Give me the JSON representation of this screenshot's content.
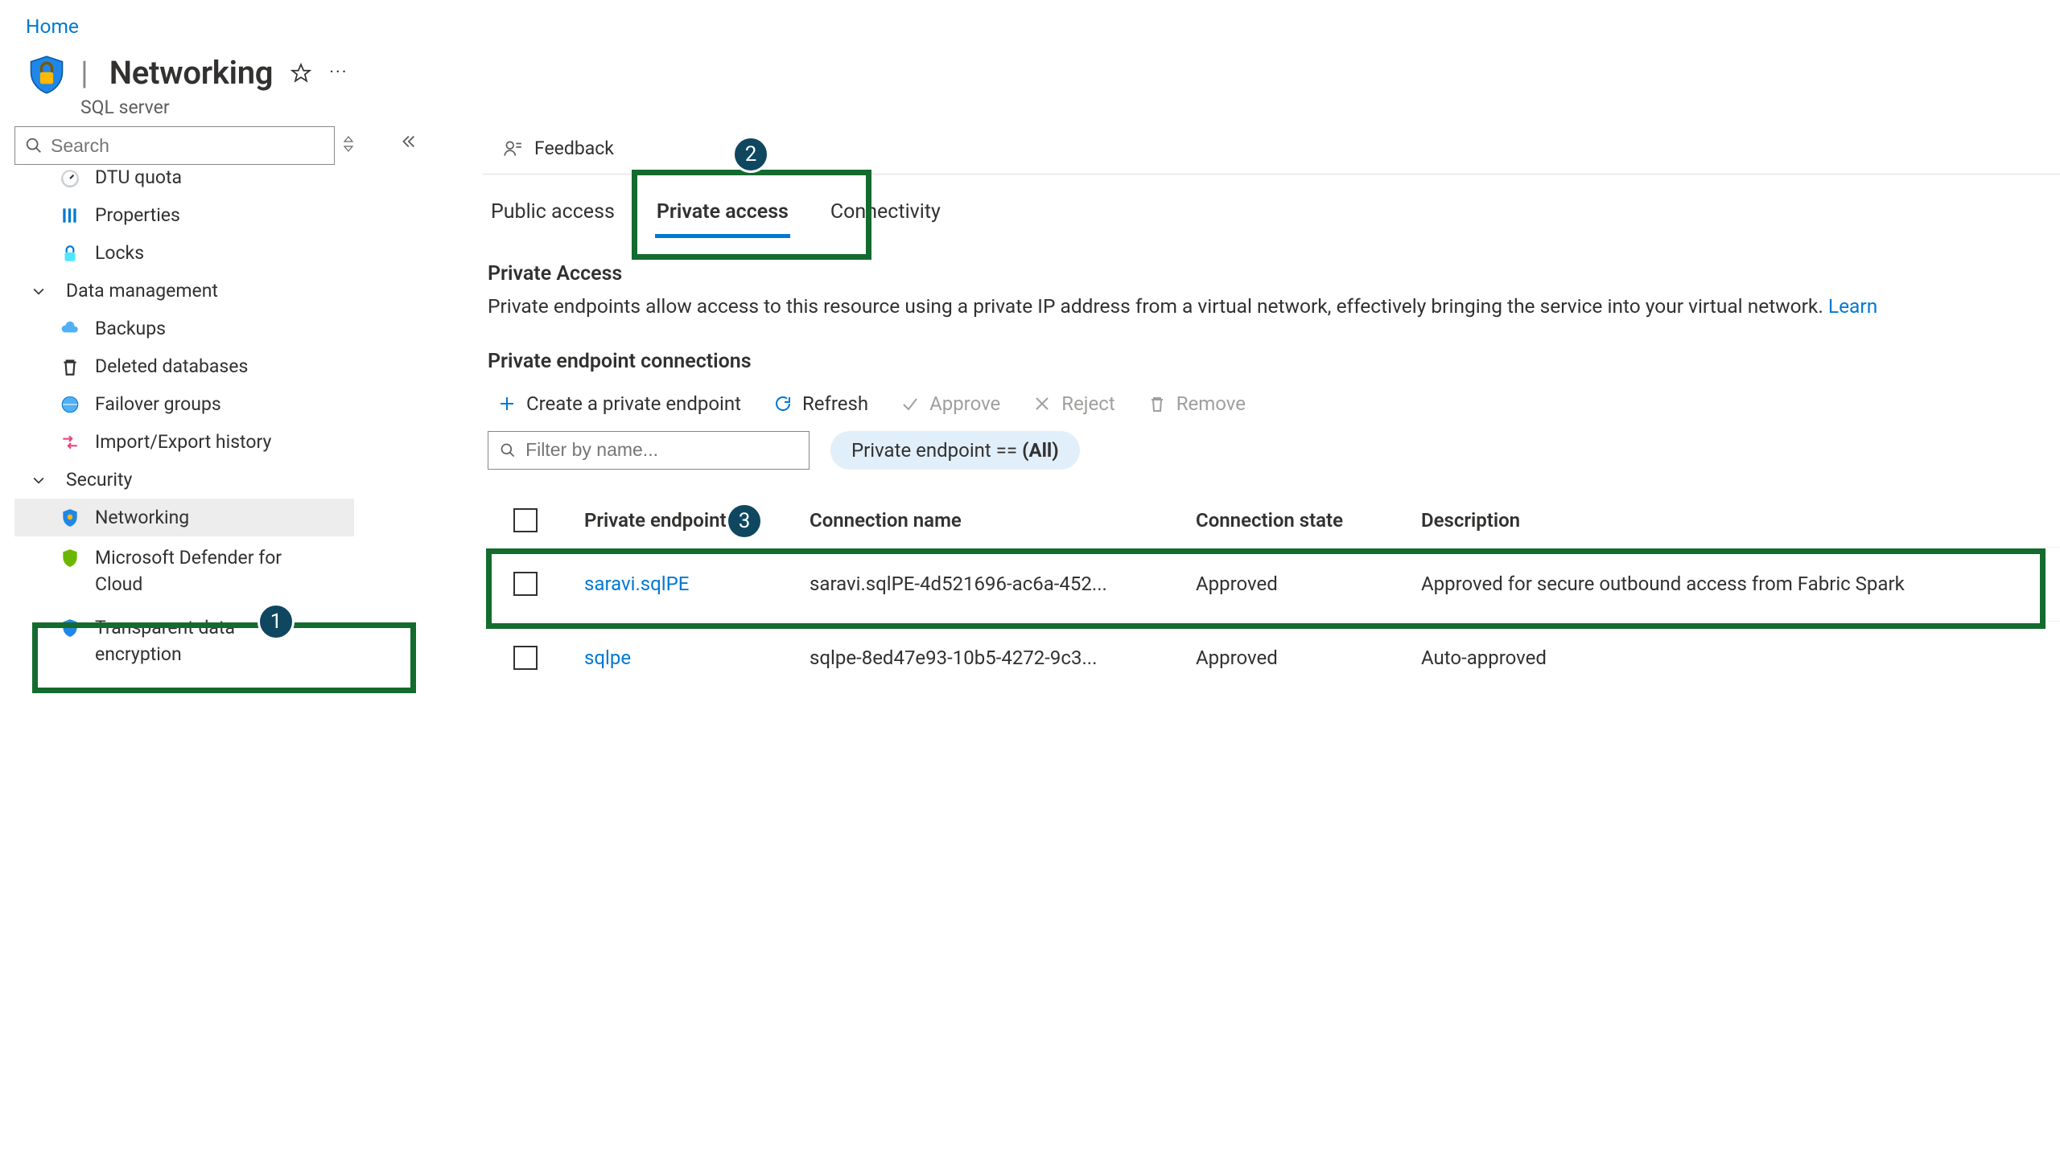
{
  "breadcrumb": {
    "home": "Home"
  },
  "header": {
    "separator": "|",
    "title": "Networking",
    "subtitle": "SQL server"
  },
  "sidebar": {
    "search_placeholder": "Search",
    "items_top": [
      {
        "id": "dtu-quota",
        "label": "DTU quota"
      },
      {
        "id": "properties",
        "label": "Properties"
      },
      {
        "id": "locks",
        "label": "Locks"
      }
    ],
    "group_data_mgmt": "Data management",
    "items_data_mgmt": [
      {
        "id": "backups",
        "label": "Backups"
      },
      {
        "id": "deleted-databases",
        "label": "Deleted databases"
      },
      {
        "id": "failover-groups",
        "label": "Failover groups"
      },
      {
        "id": "import-export-history",
        "label": "Import/Export history"
      }
    ],
    "group_security": "Security",
    "items_security": [
      {
        "id": "networking",
        "label": "Networking"
      },
      {
        "id": "defender",
        "label": "Microsoft Defender for Cloud"
      },
      {
        "id": "tde",
        "label": "Transparent data encryption"
      }
    ]
  },
  "main": {
    "feedback": "Feedback",
    "tabs": {
      "public": "Public access",
      "private": "Private access",
      "connectivity": "Connectivity"
    },
    "section_title": "Private Access",
    "section_desc": "Private endpoints allow access to this resource using a private IP address from a virtual network, effectively bringing the service into your virtual network. ",
    "learn_link": "Learn",
    "connections_title": "Private endpoint connections",
    "toolbar": {
      "create": "Create a private endpoint",
      "refresh": "Refresh",
      "approve": "Approve",
      "reject": "Reject",
      "remove": "Remove"
    },
    "filter": {
      "placeholder": "Filter by name...",
      "pill_prefix": "Private endpoint == ",
      "pill_value": "(All)"
    },
    "columns": {
      "endpoint": "Private endpoint",
      "connection": "Connection name",
      "state": "Connection state",
      "description": "Description"
    },
    "rows": [
      {
        "endpoint": "saravi.sqlPE",
        "connection": "saravi.sqlPE-4d521696-ac6a-452...",
        "state": "Approved",
        "description": "Approved for secure outbound access from Fabric Spark"
      },
      {
        "endpoint": "sqlpe",
        "connection": "sqlpe-8ed47e93-10b5-4272-9c3...",
        "state": "Approved",
        "description": "Auto-approved"
      }
    ]
  },
  "callouts": {
    "1": "1",
    "2": "2",
    "3": "3"
  }
}
